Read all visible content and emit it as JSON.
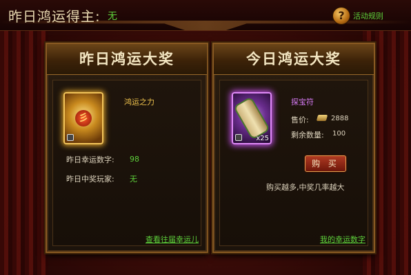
{
  "header": {
    "winner_label": "昨日鸿运得主:",
    "winner_value": "无",
    "help_icon": "?",
    "rules_link": "活动规则"
  },
  "left_panel": {
    "title": "昨日鸿运大奖",
    "item_name": "鸿运之力",
    "item_icon": "lucky-power-card-icon",
    "lucky_number_label": "昨日幸运数字:",
    "lucky_number_value": "98",
    "winner_player_label": "昨日中奖玩家:",
    "winner_player_value": "无",
    "history_link": "查看往届幸运儿"
  },
  "right_panel": {
    "title": "今日鸿运大奖",
    "item_name": "探宝符",
    "item_icon": "treasure-scroll-icon",
    "quantity_badge": "x25",
    "price_label": "售价:",
    "price_value": "2888",
    "remaining_label": "剩余数量:",
    "remaining_value": "100",
    "buy_button": "购 买",
    "note": "购买越多,中奖几率越大",
    "my_numbers_link": "我的幸运数字"
  },
  "colors": {
    "accent_green": "#5ed13b",
    "gold_text": "#f0c34d",
    "purple_text": "#d479f2"
  }
}
